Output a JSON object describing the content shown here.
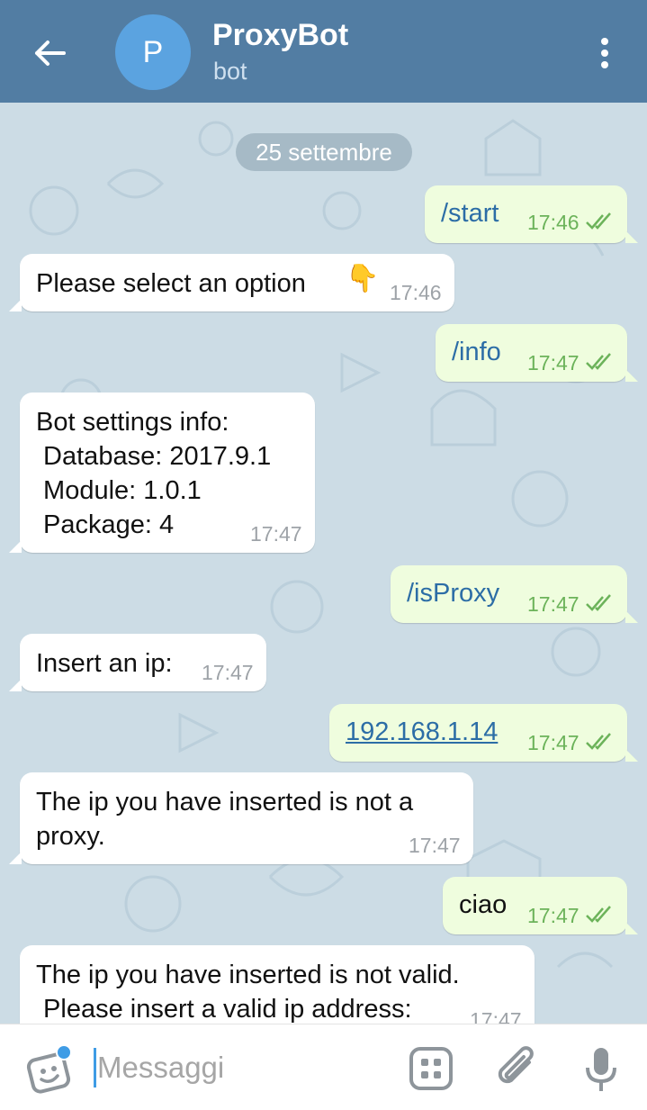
{
  "header": {
    "avatar_letter": "P",
    "title": "ProxyBot",
    "subtitle": "bot",
    "back_icon": "arrow-left-icon",
    "menu_icon": "kebab-menu-icon"
  },
  "chat": {
    "date_label": "25 settembre",
    "messages": [
      {
        "dir": "out",
        "text": "/start",
        "time": "17:46",
        "read": true
      },
      {
        "dir": "in",
        "text": "Please select an option",
        "emoji": "👇",
        "time": "17:46"
      },
      {
        "dir": "out",
        "text": "/info",
        "time": "17:47",
        "read": true
      },
      {
        "dir": "in",
        "lines": [
          "Bot settings info:",
          " Database: 2017.9.1",
          " Module: 1.0.1",
          " Package: 4"
        ],
        "time": "17:47"
      },
      {
        "dir": "out",
        "text": "/isProxy",
        "time": "17:47",
        "read": true
      },
      {
        "dir": "in",
        "text": "Insert an ip:",
        "time": "17:47"
      },
      {
        "dir": "out",
        "text": "192.168.1.14",
        "time": "17:47",
        "read": true,
        "is_link": true
      },
      {
        "dir": "in",
        "lines": [
          "The ip you have inserted is not a",
          "proxy."
        ],
        "time": "17:47"
      },
      {
        "dir": "out",
        "text": "ciao",
        "time": "17:47",
        "read": true
      },
      {
        "dir": "in",
        "lines": [
          "The ip you have inserted is not valid.",
          " Please insert a valid ip address:"
        ],
        "time": "17:47"
      }
    ]
  },
  "input_bar": {
    "placeholder": "Messaggi",
    "sticker_icon": "sticker-icon",
    "bot_commands_icon": "bot-commands-icon",
    "attach_icon": "paperclip-icon",
    "mic_icon": "microphone-icon"
  },
  "colors": {
    "header_bg": "#527da3",
    "avatar_bg": "#5ba3e0",
    "outgoing_bubble": "#effdde",
    "incoming_bubble": "#ffffff",
    "check_color": "#6cb35a",
    "accent": "#3f9ce5"
  }
}
